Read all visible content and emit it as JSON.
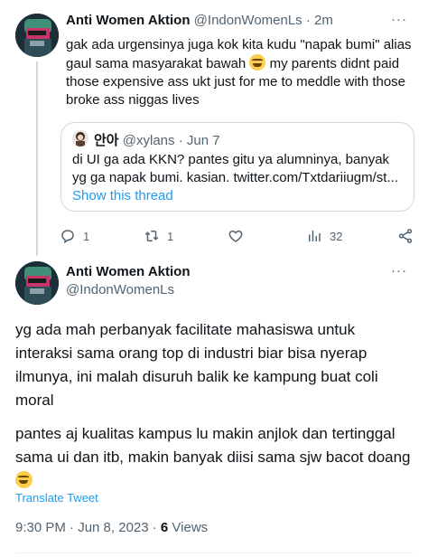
{
  "tweet1": {
    "display_name": "Anti Women Aktion",
    "handle": "@IndonWomenLs",
    "separator": "·",
    "time": "2m",
    "more": "···",
    "text_before_emoji": "gak ada urgensinya juga kok kita kudu \"napak bumi\" alias gaul sama masyarakat bawah",
    "text_after_emoji": " my parents didnt paid those expensive ass ukt just for me to meddle with those broke ass niggas lives",
    "quote": {
      "display_name": "안아",
      "handle": "@xylans",
      "separator": "·",
      "date": "Jun 7",
      "text": "di UI ga ada KKN? pantes gitu ya alumninya, banyak yg ga napak bumi. kasian. twitter.com/Txtdariiugm/st...",
      "show_thread": "Show this thread"
    },
    "actions": {
      "replies": "1",
      "retweets": "1",
      "likes": "",
      "views": "32"
    }
  },
  "tweet2": {
    "display_name": "Anti Women Aktion",
    "handle": "@IndonWomenLs",
    "more": "···",
    "paragraph1": "yg ada mah perbanyak facilitate mahasiswa untuk interaksi sama orang top di industri biar bisa nyerap ilmunya, ini malah disuruh balik ke kampung buat coli moral",
    "paragraph2": "pantes aj kualitas kampus lu makin anjlok dan tertinggal sama ui dan itb, makin banyak diisi sama sjw bacot doang",
    "translate": "Translate Tweet",
    "timestamp": "9:30 PM · Jun 8, 2023 · ",
    "views_count": "6",
    "views_label": " Views"
  },
  "icons": {
    "reply": "reply-icon",
    "retweet": "retweet-icon",
    "like": "heart-icon",
    "views": "views-icon",
    "share": "share-icon",
    "emoji1": "joy-emoji",
    "emoji2": "rofl-emoji"
  },
  "colors": {
    "accent": "#1d9bf0",
    "muted": "#536471",
    "text": "#0f1419",
    "border": "#cfd9de",
    "thread_line": "#cfd9de"
  }
}
